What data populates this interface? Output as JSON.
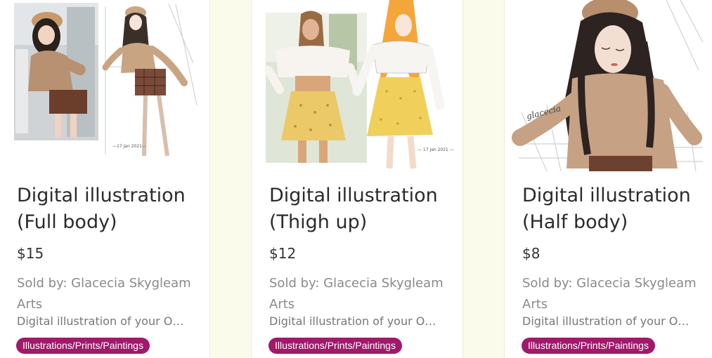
{
  "listings": [
    {
      "title": "Digital illustration (Full body)",
      "price": "$15",
      "seller": "Sold by: Glacecia Skygleam Arts",
      "description": "Digital illustration of your OOTD",
      "tag": "Illustrations/Prints/Paintings",
      "image_icon": "full-body-illustration"
    },
    {
      "title": "Digital illustration (Thigh up)",
      "price": "$12",
      "seller": "Sold by: Glacecia Skygleam Arts",
      "description": "Digital illustration of your OOTD",
      "tag": "Illustrations/Prints/Paintings",
      "image_icon": "thigh-up-illustration"
    },
    {
      "title": "Digital illustration (Half body)",
      "price": "$8",
      "seller": "Sold by: Glacecia Skygleam Arts",
      "description": "Digital illustration of your OOTD",
      "tag": "Illustrations/Prints/Paintings",
      "image_icon": "half-body-illustration"
    }
  ],
  "colors": {
    "page_background": "#fbfbec",
    "card_background": "#ffffff",
    "tag_background": "#a0196b",
    "tag_text": "#ffffff",
    "title_text": "#2b2b2b",
    "seller_text": "#8a8a8a"
  }
}
